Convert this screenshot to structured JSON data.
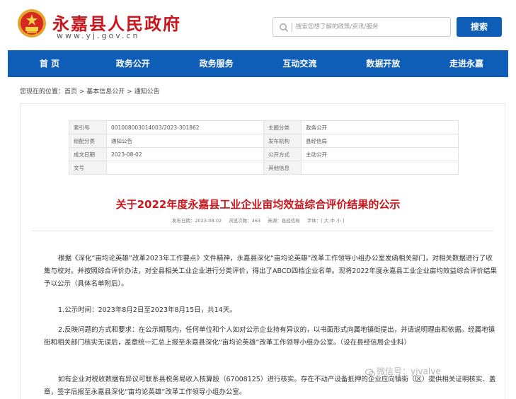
{
  "header": {
    "site_title": "永嘉县人民政府",
    "site_url": "www.yj.gov.cn",
    "search_placeholder": "搜索您想了解的政策/资讯/服务",
    "search_button": "搜索"
  },
  "nav": {
    "items": [
      "首 页",
      "政务公开",
      "政务服务",
      "互动交流",
      "数据开放",
      "走进永嘉"
    ]
  },
  "breadcrumb": {
    "prefix": "您现在的位置：",
    "items": [
      "首页",
      "基本信息公开",
      "通知公告"
    ],
    "separator": " > "
  },
  "meta": {
    "rows": [
      {
        "k1": "索引号",
        "v1": "001008003014003/2023-301862",
        "k2": "主题分类",
        "v2": "政务公开"
      },
      {
        "k1": "组配分类",
        "v1": "通知公告",
        "k2": "发布机构",
        "v2": "县经信局"
      },
      {
        "k1": "成文日期",
        "v1": "2023-08-02",
        "k2": "公开方式",
        "v2": "主动公开"
      },
      {
        "k1": "文号",
        "v1": "",
        "k2": "其他信息",
        "v2": ""
      }
    ]
  },
  "article": {
    "title": "关于2022年度永嘉县工业企业亩均效益综合评价结果的公示",
    "publish_date": "发布日期：2023-08-02",
    "views": "浏览次数：463",
    "source": "来源：县经信局",
    "font_size": "字体：[ 大 中 小 ]",
    "paragraphs": [
      "根据《深化“亩均论英雄”改革2023年工作要点》文件精神，永嘉县深化“亩均论英雄”改革工作领导小组办公室发函相关部门，对相关数据进行了收集与校对。并按照综合评价办法，对全县相关工业企业进行分类评价，得出了ABCD四档企业名单。现将2022年度永嘉县工业企业亩均效益综合评价结果予以公示（具体名单附后）。",
      "1.公示时间：2023年8月2日至2023年8月15日，共14天。",
      "2.反映问题的方式和要求：在公示期限内，任何单位和个人如对公示企业持有异议的，以书面形式向属地镇街提出，并请说明理由和依据。经属地镇街和相关部门核实无误后，盖章统一汇总上报至永嘉县深化“亩均论英雄”改革工作领导小组办公室。（设在县经信局企业科）",
      "如有企业对税收数据有异议可联系县税务局收入核算股（67008125）进行核实。存在不动产设备抵押的企业应向镇街（区）提供相关证明核实、盖章，签字后报至永嘉县深化“亩均论英雄”改革工作领导小组办公室。"
    ]
  },
  "watermark": "微信号：yjvalve",
  "colors": {
    "brand_red": "#c8161d",
    "nav_blue": "#0e5db7"
  }
}
